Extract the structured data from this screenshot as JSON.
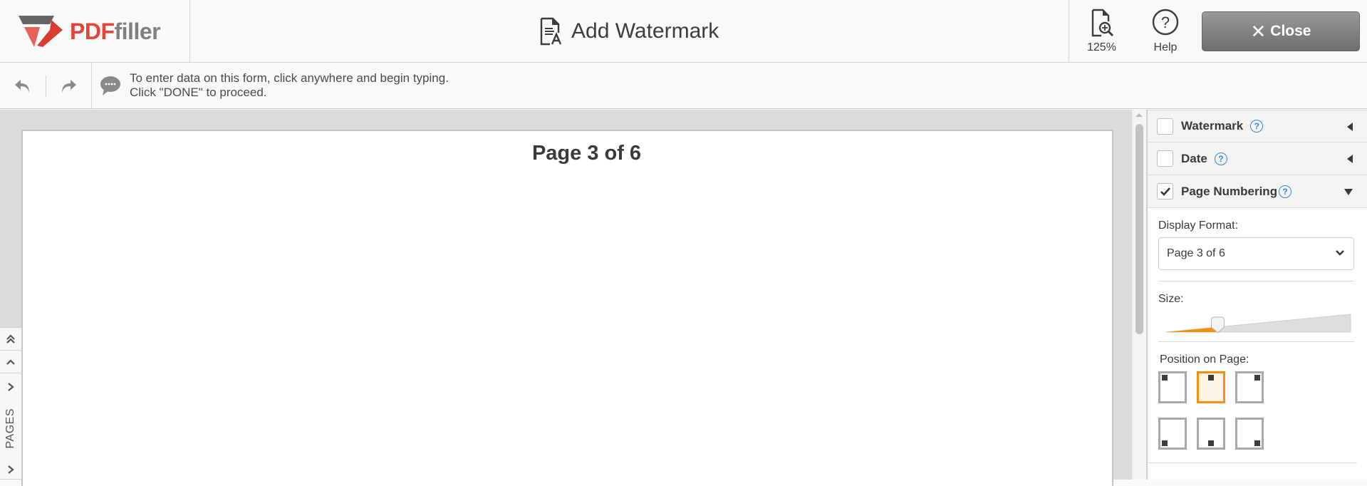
{
  "header": {
    "logo": {
      "part1": "PDF",
      "part2": "filler"
    },
    "title": "Add Watermark",
    "title_icon": "document-text-icon",
    "zoom": {
      "icon": "zoom-document-icon",
      "label": "125%"
    },
    "help": {
      "icon": "help-circle-icon",
      "label": "Help"
    },
    "close": {
      "icon": "close-icon",
      "label": "Close"
    }
  },
  "toolbar": {
    "undo_icon": "undo-icon",
    "redo_icon": "redo-icon",
    "hint_icon": "chat-bubble-icon",
    "hint_line1": "To enter data on this form, click anywhere and begin typing.",
    "hint_line2": "Click \"DONE\" to proceed."
  },
  "document": {
    "page_number_text": "Page 3 of 6"
  },
  "pages_tab": {
    "label": "PAGES"
  },
  "panel": {
    "sections": [
      {
        "label": "Watermark",
        "checked": false,
        "expanded": false
      },
      {
        "label": "Date",
        "checked": false,
        "expanded": false
      },
      {
        "label": "Page Numbering",
        "checked": true,
        "expanded": true
      }
    ],
    "help_glyph": "?",
    "display_format": {
      "label": "Display Format:",
      "value": "Page 3 of 6"
    },
    "size": {
      "label": "Size:",
      "value_fraction": 0.28
    },
    "position": {
      "label": "Position on Page:",
      "options": [
        "top-left",
        "top-center",
        "top-right",
        "bottom-left",
        "bottom-center",
        "bottom-right"
      ],
      "selected": "top-center"
    }
  },
  "colors": {
    "brand_red": "#e2463a",
    "accent_orange": "#f4900c",
    "help_blue": "#2e8be0"
  }
}
